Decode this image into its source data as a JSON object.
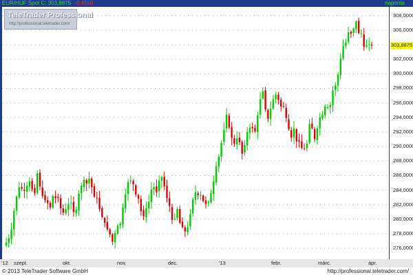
{
  "header": {
    "symbol": "EUR/HUF Spot",
    "close_text": "C: 303,8875",
    "change_text": "-0,4550",
    "period": "naponta"
  },
  "watermark": {
    "name": "TeleTrader Professional",
    "url": "http://professional.teletrader.com/"
  },
  "footer": {
    "copyright": "© 2013 TeleTrader Software GmbH",
    "url": "http://professional.teletrader.com/"
  },
  "last_price": "303,8875",
  "colors": {
    "up": "#00cc00",
    "down": "#dd0000",
    "frame": "#1d3d8c",
    "last_label": "#ffff00"
  },
  "chart_data": {
    "type": "candlestick",
    "x_tick_labels": [
      "'12",
      "szept.",
      "okt.",
      "nov.",
      "dec.",
      "'13",
      "febr.",
      "márc.",
      "ápr."
    ],
    "y_tick_labels": [
      "276,0000",
      "278,0000",
      "280,0000",
      "282,0000",
      "284,0000",
      "286,0000",
      "288,0000",
      "290,0000",
      "292,0000",
      "294,0000",
      "296,0000",
      "298,0000",
      "300,0000",
      "302,0000",
      "304,0000",
      "306,0000",
      "308,0000"
    ],
    "ylim": [
      274.5,
      309.2
    ],
    "grid": true,
    "closes": [
      276.8,
      277.4,
      278.6,
      281.1,
      283.1,
      284.4,
      284.2,
      283.9,
      284.6,
      285.2,
      284.1,
      283.6,
      286.3,
      284.5,
      283.2,
      282.6,
      282.2,
      281.6,
      283.2,
      282.9,
      282.9,
      281.5,
      280.9,
      281.4,
      282.1,
      282.3,
      281.0,
      281.3,
      283.5,
      284.6,
      285.4,
      284.9,
      285.6,
      284.4,
      283.1,
      282.9,
      281.4,
      280.3,
      279.5,
      278.6,
      277.9,
      276.9,
      278.1,
      279.1,
      279.4,
      281.6,
      283.4,
      285.1,
      285.3,
      284.8,
      283.4,
      282.8,
      281.1,
      280.4,
      281.5,
      282.4,
      284.1,
      284.4,
      283.7,
      285.3,
      285.8,
      284.5,
      282.9,
      281.8,
      279.9,
      280.1,
      281.4,
      279.5,
      278.9,
      278.3,
      278.9,
      280.7,
      282.7,
      283.7,
      283.3,
      283.3,
      282.5,
      282.1,
      282.4,
      283.6,
      285.2,
      287.3,
      288.6,
      290.5,
      292.3,
      294.4,
      292.6,
      291.2,
      290.4,
      291.1,
      290.6,
      289.0,
      290.2,
      292.0,
      292.6,
      292.5,
      292.1,
      294.3,
      296.5,
      297.6,
      295.1,
      293.8,
      295.2,
      296.5,
      297.2,
      296.4,
      295.5,
      295.5,
      293.9,
      292.4,
      291.2,
      292.5,
      290.7,
      290.7,
      289.8,
      289.7,
      290.4,
      293.1,
      292.5,
      291.0,
      292.5,
      294.0,
      294.4,
      295.5,
      295.4,
      295.7,
      297.7,
      298.4,
      299.9,
      302.1,
      303.8,
      304.3,
      305.7,
      305.5,
      306.2,
      307.2,
      305.6,
      305.6,
      303.7,
      303.9,
      304.1,
      303.9
    ],
    "last_value": 303.8875
  }
}
